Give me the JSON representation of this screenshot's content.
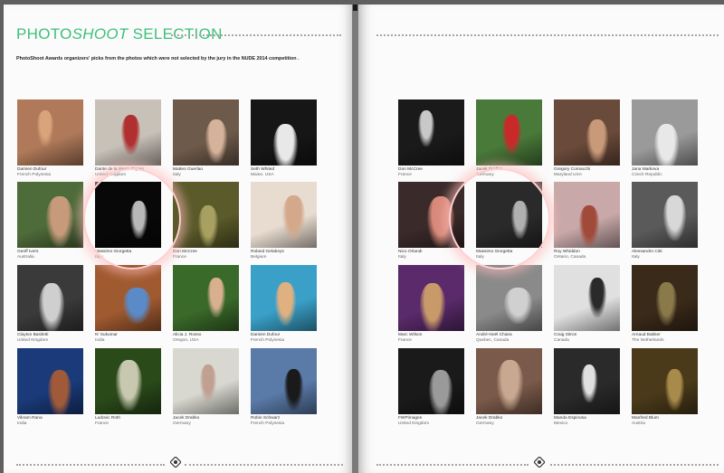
{
  "left_page": {
    "title_part1": "PHOTO",
    "title_part2": "SHOOT",
    "title_part3": " SELECTION",
    "subtitle": "PhotoShoot Awards organizers' picks from the photos which were not selected by the jury in the NUDE 2014 competition ."
  },
  "left_photos": [
    {
      "name": "Damien Dufour",
      "loc": "French Polynesia",
      "bg": "#b07a5a",
      "fg": "#d9a37c"
    },
    {
      "name": "Dante de la Sierra Tejano",
      "loc": "United Kingdom",
      "bg": "#c8c1b8",
      "fg": "#b03030"
    },
    {
      "name": "Matteo Guerlao",
      "loc": "Italy",
      "bg": "#6e5a4a",
      "fg": "#d5b39a"
    },
    {
      "name": "Seth Whited",
      "loc": "Maine, USA",
      "bg": "#161616",
      "fg": "#e8e8e8"
    },
    {
      "name": "Geoff Ivers",
      "loc": "Australia",
      "bg": "#4e6b3a",
      "fg": "#c69a7a"
    },
    {
      "name": "Massimo Giorgetta",
      "loc": "Italy",
      "bg": "#080808",
      "fg": "#b8b8b8"
    },
    {
      "name": "Don McCree",
      "loc": "France",
      "bg": "#5a5a2a",
      "fg": "#a8a060"
    },
    {
      "name": "Roland Gelabeys",
      "loc": "Belgium",
      "bg": "#e8dcd0",
      "fg": "#d4a88a"
    },
    {
      "name": "Clayton Basiletti",
      "loc": "United Kingdom",
      "bg": "#3a3a3a",
      "fg": "#cfcfcf"
    },
    {
      "name": "N' Sukumar",
      "loc": "India",
      "bg": "#a05a30",
      "fg": "#5a8ac8"
    },
    {
      "name": "Alicia J. Rosso",
      "loc": "Oregon, USA",
      "bg": "#3a6a2a",
      "fg": "#d8b090"
    },
    {
      "name": "Damien Dufour",
      "loc": "French Polynesia",
      "bg": "#3aa0c8",
      "fg": "#e0b080"
    },
    {
      "name": "Vikram Rana",
      "loc": "India",
      "bg": "#1a3a7a",
      "fg": "#a05a3a"
    },
    {
      "name": "Ludovic Roth",
      "loc": "France",
      "bg": "#2a4a1a",
      "fg": "#c8c8b0"
    },
    {
      "name": "Jacek Drabko",
      "loc": "Germany",
      "bg": "#d8d8d0",
      "fg": "#c0a090"
    },
    {
      "name": "Robin Schwarz",
      "loc": "French Polynesia",
      "bg": "#5a7aa8",
      "fg": "#1a1a1a"
    }
  ],
  "right_photos": [
    {
      "name": "Don McCree",
      "loc": "France",
      "bg": "#1a1a1a",
      "fg": "#c8c8c8"
    },
    {
      "name": "Jacek Drabko",
      "loc": "Germany",
      "bg": "#4a7a3a",
      "fg": "#c82a2a"
    },
    {
      "name": "Gregory Cornacchi",
      "loc": "Maryland USA",
      "bg": "#6a4a3a",
      "fg": "#c89a7a"
    },
    {
      "name": "Jana Markova",
      "loc": "Czech Republic",
      "bg": "#9a9a9a",
      "fg": "#e8e8e8"
    },
    {
      "name": "Nico Orlandi",
      "loc": "Italy",
      "bg": "#3a2a2a",
      "fg": "#d88a7a"
    },
    {
      "name": "Massimo Giorgetta",
      "loc": "Italy",
      "bg": "#2a2a2a",
      "fg": "#b0b0b0"
    },
    {
      "name": "Roy Whiddon",
      "loc": "Ontario, Canada",
      "bg": "#c8a8a8",
      "fg": "#a04a3a"
    },
    {
      "name": "Alessandro Citti",
      "loc": "Italy",
      "bg": "#5a5a5a",
      "fg": "#d8d8d8"
    },
    {
      "name": "Marc Wilson",
      "loc": "France",
      "bg": "#5a2a6a",
      "fg": "#c89a6a"
    },
    {
      "name": "André-Noël Chiara",
      "loc": "Quebec, Canada",
      "bg": "#8a8a8a",
      "fg": "#d0d0d0"
    },
    {
      "name": "Craig Sitron",
      "loc": "Canada",
      "bg": "#e0e0e0",
      "fg": "#2a2a2a"
    },
    {
      "name": "Arnaud Bakker",
      "loc": "The Netherlands",
      "bg": "#3a2a1a",
      "fg": "#8a7a4a"
    },
    {
      "name": "FWPimages",
      "loc": "United Kingdom",
      "bg": "#1a1a1a",
      "fg": "#9a9a9a"
    },
    {
      "name": "Jacek Drabko",
      "loc": "Germany",
      "bg": "#7a5a4a",
      "fg": "#c8a890"
    },
    {
      "name": "Manda Espinosa",
      "loc": "Mexico",
      "bg": "#2a2a2a",
      "fg": "#e0e0e0"
    },
    {
      "name": "Manfred Blum",
      "loc": "Austria",
      "bg": "#4a3a1a",
      "fg": "#a88a4a"
    }
  ],
  "colors": {
    "title_accent": "#3cc07a",
    "highlight": "#ffbdbd",
    "page": "#fbfbfb"
  }
}
